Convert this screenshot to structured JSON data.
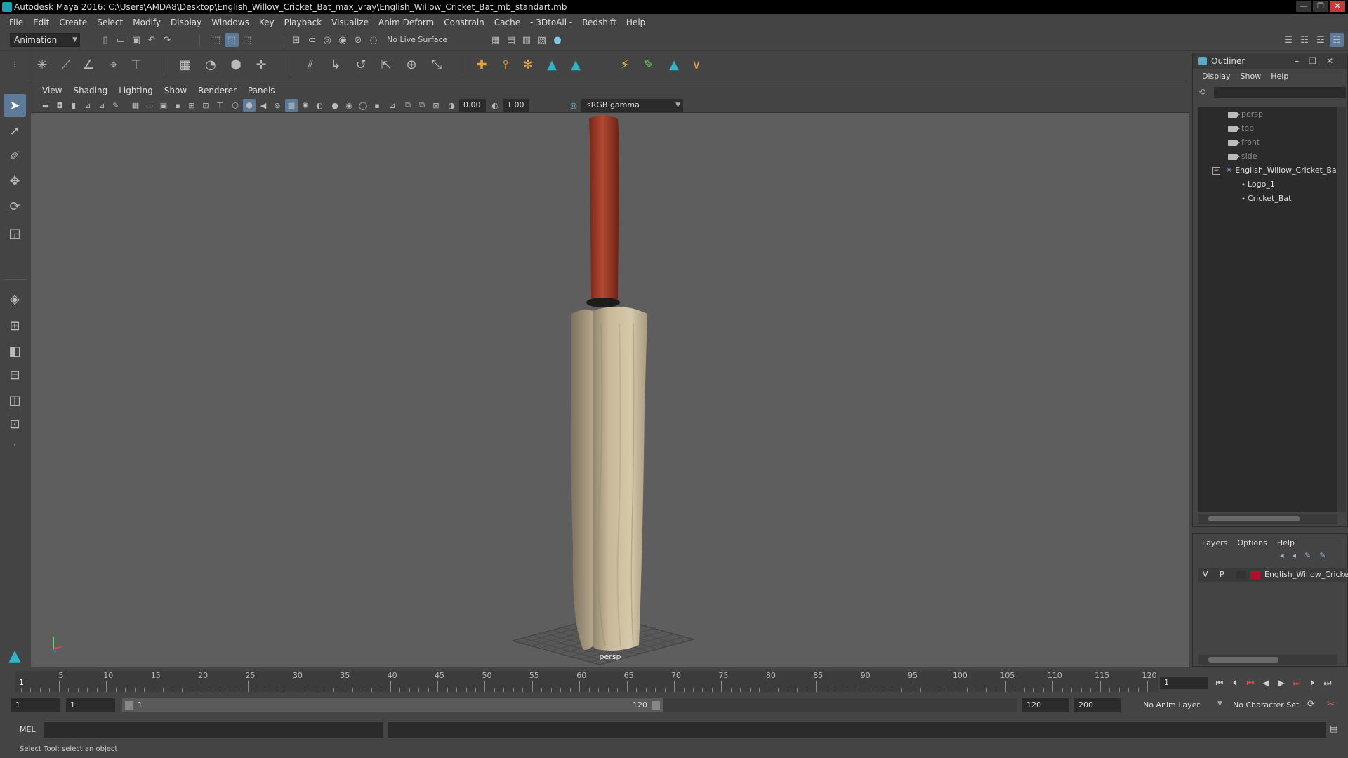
{
  "window": {
    "title": "Autodesk Maya 2016: C:\\Users\\AMDA8\\Desktop\\English_Willow_Cricket_Bat_max_vray\\English_Willow_Cricket_Bat_mb_standart.mb",
    "controls": [
      "—",
      "❐",
      "✕"
    ]
  },
  "menubar": [
    "File",
    "Edit",
    "Create",
    "Select",
    "Modify",
    "Display",
    "Windows",
    "Key",
    "Playback",
    "Visualize",
    "Anim Deform",
    "Constrain",
    "Cache",
    "- 3DtoAll -",
    "Redshift",
    "Help"
  ],
  "toolbar": {
    "menuset": "Animation",
    "live_surface": "No Live Surface"
  },
  "panel_menu": [
    "View",
    "Shading",
    "Lighting",
    "Show",
    "Renderer",
    "Panels"
  ],
  "panel_toolbar": {
    "exposure": "0.00",
    "gamma": "1.00",
    "color_space": "sRGB gamma"
  },
  "viewport": {
    "camera_label": "persp"
  },
  "outliner": {
    "title": "Outliner",
    "menu": [
      "Display",
      "Show",
      "Help"
    ],
    "items": [
      {
        "label": "persp",
        "kind": "camera"
      },
      {
        "label": "top",
        "kind": "camera"
      },
      {
        "label": "front",
        "kind": "camera"
      },
      {
        "label": "side",
        "kind": "camera"
      },
      {
        "label": "English_Willow_Cricket_Ba",
        "kind": "group"
      },
      {
        "label": "Logo_1",
        "kind": "mesh"
      },
      {
        "label": "Cricket_Bat",
        "kind": "mesh"
      }
    ]
  },
  "layers": {
    "menu": [
      "Layers",
      "Options",
      "Help"
    ],
    "row": {
      "v": "V",
      "p": "P",
      "name": "English_Willow_Cricke",
      "color": "#b0102a"
    }
  },
  "timeline": {
    "ticks": [
      "5",
      "10",
      "15",
      "20",
      "25",
      "30",
      "35",
      "40",
      "45",
      "50",
      "55",
      "60",
      "65",
      "70",
      "75",
      "80",
      "85",
      "90",
      "95",
      "100",
      "105",
      "110",
      "115",
      "120"
    ],
    "current_frame": "1",
    "frame_field": "1"
  },
  "range": {
    "start": "1",
    "inner_start": "1",
    "bar_start": "1",
    "bar_end": "120",
    "end": "120",
    "anim_end": "200",
    "anim_layer": "No Anim Layer",
    "character_set": "No Character Set"
  },
  "commandline": {
    "label": "MEL"
  },
  "status": {
    "help": "Select Tool: select an object"
  }
}
